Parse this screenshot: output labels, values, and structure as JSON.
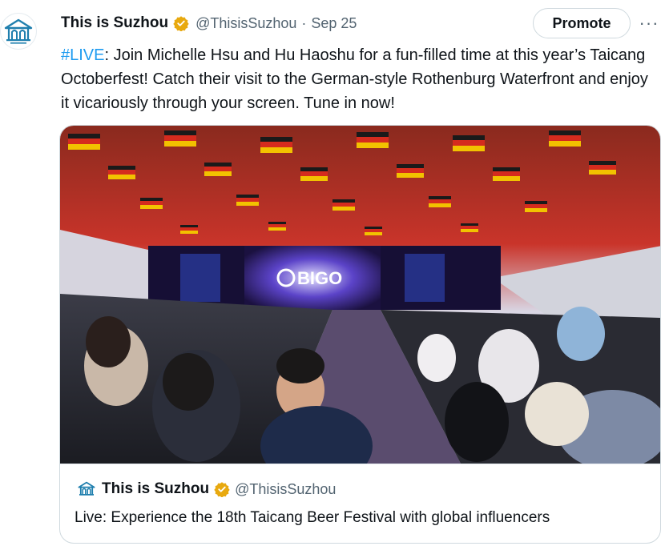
{
  "tweet": {
    "author_name": "This is Suzhou",
    "handle": "@ThisisSuzhou",
    "separator": "·",
    "date": "Sep 25",
    "promote_label": "Promote",
    "more_label": "···",
    "hashtag": "#LIVE",
    "body": ": Join Michelle Hsu and Hu Haoshu for a fun-filled time at this year’s Taicang Octoberfest! Catch their visit to the German-style Rothenburg Waterfront and enjoy it vicariously through your screen. Tune in now!"
  },
  "media": {
    "stage_logo_text": "BIGO",
    "description_icon": "festival-tent-photo"
  },
  "card": {
    "author_name": "This is Suzhou",
    "handle": "@ThisisSuzhou",
    "title": "Live: Experience the 18th Taicang Beer Festival with global influencers"
  },
  "colors": {
    "link": "#1d9bf0",
    "verified": "#e8a90f",
    "secondary_text": "#536471",
    "logo_blue": "#1f7fae"
  }
}
